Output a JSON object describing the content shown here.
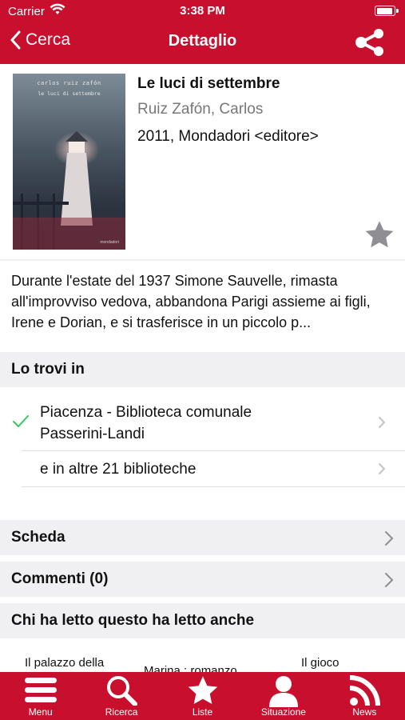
{
  "status_bar": {
    "carrier": "Carrier",
    "time": "3:38 PM"
  },
  "nav": {
    "back_label": "Cerca",
    "title": "Dettaglio"
  },
  "book": {
    "title": "Le luci di settembre",
    "author": "Ruiz Zafón, Carlos",
    "edition": "2011, Mondadori <editore>",
    "cover": {
      "author": "carlos ruiz zafón",
      "title": "le luci di settembre",
      "publisher": "mondadori"
    }
  },
  "abstract": "Durante l'estate del 1937 Simone Sauvelle, rimasta all'improvviso vedova, abbandona Parigi assieme ai figli, Irene e Dorian, e si trasferisce in un piccolo p...",
  "availability": {
    "header": "Lo trovi in",
    "libraries": [
      {
        "label_line1": "Piacenza - Biblioteca comunale",
        "label_line2": "Passerini-Landi",
        "available": true
      },
      {
        "label": "e in altre 21 biblioteche"
      }
    ]
  },
  "sections": {
    "scheda": "Scheda",
    "comments": "Commenti (0)",
    "related": "Chi ha letto questo ha letto anche"
  },
  "related_items": [
    "Il palazzo della",
    "Marina : romanzo",
    "Il gioco"
  ],
  "tabs": [
    {
      "label": "Menu",
      "icon": "menu-icon"
    },
    {
      "label": "Ricerca",
      "icon": "search-icon"
    },
    {
      "label": "Liste",
      "icon": "star-icon"
    },
    {
      "label": "Situazione",
      "icon": "user-icon"
    },
    {
      "label": "News",
      "icon": "rss-icon"
    }
  ],
  "colors": {
    "brand_red": "#c8102e",
    "section_bg": "#f0f0f2",
    "check_green": "#34c759",
    "star_gray": "#8e8e93"
  }
}
